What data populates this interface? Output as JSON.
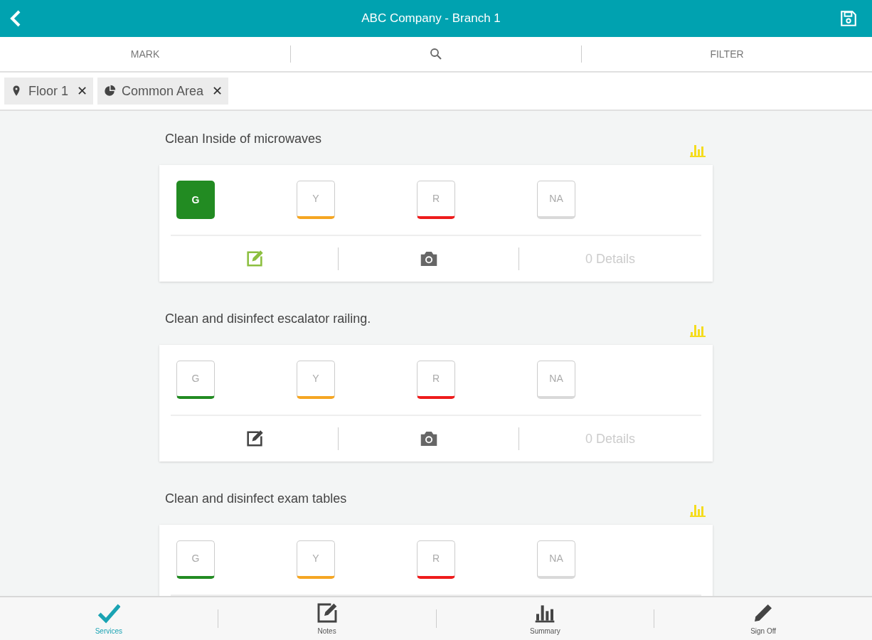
{
  "header": {
    "title": "ABC Company - Branch 1"
  },
  "toolbar": {
    "mark": "MARK",
    "filter": "FILTER"
  },
  "chips": [
    {
      "kind": "location",
      "label": "Floor 1",
      "close": "✕"
    },
    {
      "kind": "area",
      "label": "Common Area",
      "close": "✕"
    }
  ],
  "items": [
    {
      "title": "Clean Inside of microwaves",
      "ratings": [
        {
          "label": "G",
          "color": "#228b22",
          "selected": true
        },
        {
          "label": "Y",
          "color": "#f5a623",
          "selected": false
        },
        {
          "label": "R",
          "color": "#ee1c1c",
          "selected": false
        },
        {
          "label": "NA",
          "color": "#d9d9d9",
          "selected": false
        }
      ],
      "actions": {
        "has_note": true,
        "details": "0 Details"
      }
    },
    {
      "title": "Clean and disinfect escalator railing.",
      "ratings": [
        {
          "label": "G",
          "color": "#228b22",
          "selected": false
        },
        {
          "label": "Y",
          "color": "#f5a623",
          "selected": false
        },
        {
          "label": "R",
          "color": "#ee1c1c",
          "selected": false
        },
        {
          "label": "NA",
          "color": "#d9d9d9",
          "selected": false
        }
      ],
      "actions": {
        "has_note": false,
        "details": "0 Details"
      }
    },
    {
      "title": "Clean and disinfect exam tables",
      "ratings": [
        {
          "label": "G",
          "color": "#228b22",
          "selected": false
        },
        {
          "label": "Y",
          "color": "#f5a623",
          "selected": false
        },
        {
          "label": "R",
          "color": "#ee1c1c",
          "selected": false
        },
        {
          "label": "NA",
          "color": "#d9d9d9",
          "selected": false
        }
      ]
    }
  ],
  "bottom_nav": [
    {
      "kind": "services",
      "label": "Services",
      "selected": true
    },
    {
      "kind": "notes",
      "label": "Notes",
      "selected": false
    },
    {
      "kind": "summary",
      "label": "Summary",
      "selected": false
    },
    {
      "kind": "signoff",
      "label": "Sign Off",
      "selected": false
    }
  ]
}
